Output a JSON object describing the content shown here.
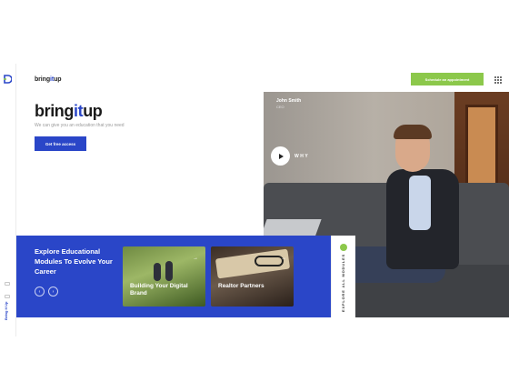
{
  "header": {
    "brand_prefix": "bring",
    "brand_accent": "it",
    "brand_suffix": "up",
    "cta_label": "Schedule an appointment"
  },
  "hero": {
    "brand_prefix": "bring",
    "brand_accent": "it",
    "brand_suffix": "up",
    "tagline": "We can give you an education that you need",
    "cta_label": "Get free access",
    "person_name": "John Smith",
    "person_role": "CEO",
    "video_label": "WHY"
  },
  "rail": {
    "vertical_text": "Bring it Up"
  },
  "banner": {
    "title": "Explore Educational Modules To Evolve Your Career",
    "prev_label": "‹",
    "next_label": "›",
    "cards": [
      {
        "title": "Building Your Digital Brand",
        "arrow": "→"
      },
      {
        "title": "Realtor Partners",
        "arrow": "→"
      }
    ],
    "side_label": "EXPLORE ALL MODULES"
  },
  "colors": {
    "accent_blue": "#2a46c8",
    "accent_green": "#8cc84b"
  }
}
